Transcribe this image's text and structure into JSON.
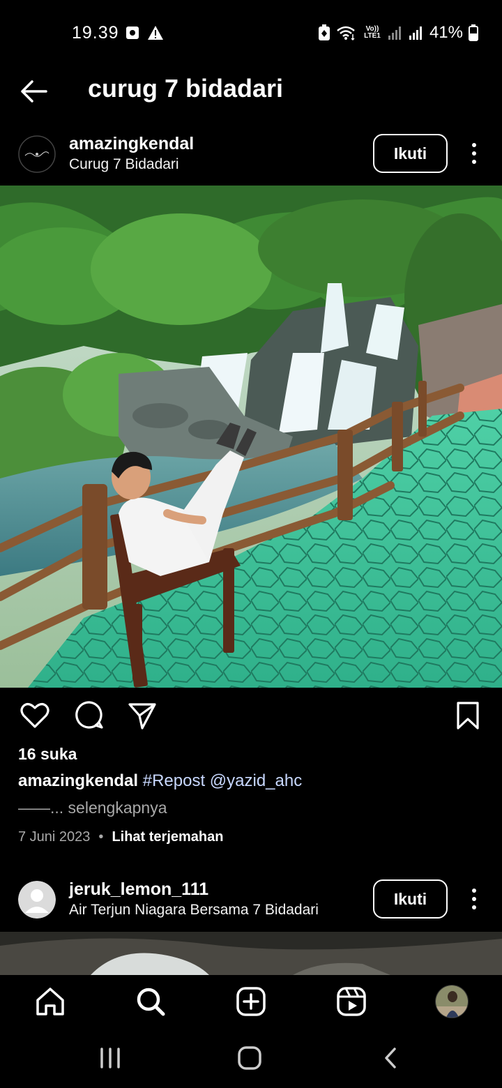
{
  "status_bar": {
    "time": "19.39",
    "network_label": "Vo)) LTE1",
    "battery": "41%"
  },
  "header": {
    "title": "curug 7 bidadari"
  },
  "post1": {
    "username": "amazingkendal",
    "location": "Curug 7 Bidadari",
    "follow_label": "Ikuti",
    "likes": "16 suka",
    "caption_user": "amazingkendal",
    "caption_text": "#Repost @yazid_ahc",
    "caption_more": "——... selengkapnya",
    "date": "7 Juni 2023",
    "translate_label": "Lihat terjemahan"
  },
  "post2": {
    "username": "jeruk_lemon_111",
    "location": "Air Terjun Niagara Bersama 7 Bidadari",
    "follow_label": "Ikuti"
  },
  "colors": {
    "background": "#000000",
    "text": "#ffffff",
    "muted": "#a8a8a8",
    "hashtag": "#c8d8ff"
  },
  "icons": {
    "back": "arrow-left-icon",
    "like": "heart-icon",
    "comment": "comment-icon",
    "share": "send-icon",
    "save": "bookmark-icon",
    "nav": [
      "home-icon",
      "search-icon",
      "add-icon",
      "reels-icon"
    ],
    "system": [
      "recent-apps-icon",
      "home-circle-icon",
      "back-chevron-icon"
    ]
  }
}
